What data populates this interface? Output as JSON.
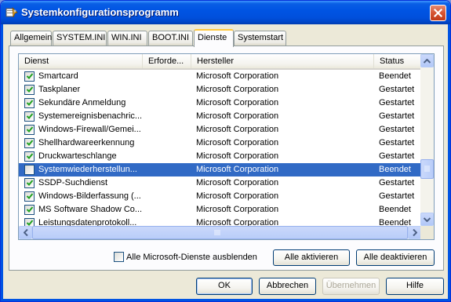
{
  "window": {
    "title": "Systemkonfigurationsprogramm"
  },
  "tabs": [
    {
      "label": "Allgemein"
    },
    {
      "label": "SYSTEM.INI"
    },
    {
      "label": "WIN.INI"
    },
    {
      "label": "BOOT.INI"
    },
    {
      "label": "Dienste",
      "active": true
    },
    {
      "label": "Systemstart"
    }
  ],
  "columns": {
    "dienst": "Dienst",
    "erforderlich": "Erforde...",
    "hersteller": "Hersteller",
    "status": "Status"
  },
  "services": [
    {
      "name": "Smartcard",
      "manufacturer": "Microsoft Corporation",
      "status": "Beendet",
      "checked": true
    },
    {
      "name": "Taskplaner",
      "manufacturer": "Microsoft Corporation",
      "status": "Gestartet",
      "checked": true
    },
    {
      "name": "Sekundäre Anmeldung",
      "manufacturer": "Microsoft Corporation",
      "status": "Gestartet",
      "checked": true
    },
    {
      "name": "Systemereignisbenachric...",
      "manufacturer": "Microsoft Corporation",
      "status": "Gestartet",
      "checked": true
    },
    {
      "name": "Windows-Firewall/Gemei...",
      "manufacturer": "Microsoft Corporation",
      "status": "Gestartet",
      "checked": true
    },
    {
      "name": "Shellhardwareerkennung",
      "manufacturer": "Microsoft Corporation",
      "status": "Gestartet",
      "checked": true
    },
    {
      "name": "Druckwarteschlange",
      "manufacturer": "Microsoft Corporation",
      "status": "Gestartet",
      "checked": true
    },
    {
      "name": "Systemwiederherstellun...",
      "manufacturer": "Microsoft Corporation",
      "status": "Beendet",
      "checked": false,
      "selected": true
    },
    {
      "name": "SSDP-Suchdienst",
      "manufacturer": "Microsoft Corporation",
      "status": "Gestartet",
      "checked": true
    },
    {
      "name": "Windows-Bilderfassung (...",
      "manufacturer": "Microsoft Corporation",
      "status": "Gestartet",
      "checked": true
    },
    {
      "name": "MS Software Shadow Co...",
      "manufacturer": "Microsoft Corporation",
      "status": "Beendet",
      "checked": true
    },
    {
      "name": "Leistungsdatenprotokoll...",
      "manufacturer": "Microsoft Corporation",
      "status": "Beendet",
      "checked": true
    }
  ],
  "controls": {
    "hide_ms_label": "Alle Microsoft-Dienste ausblenden",
    "hide_ms_checked": false,
    "enable_all": "Alle aktivieren",
    "disable_all": "Alle deaktivieren"
  },
  "buttons": {
    "ok": "OK",
    "cancel": "Abbrechen",
    "apply": "Übernehmen",
    "help": "Hilfe"
  },
  "colors": {
    "title_bar": "#0054e3",
    "selection": "#316ac5",
    "checkmark": "#21a121",
    "active_tab_accent": "#ffc83c"
  }
}
